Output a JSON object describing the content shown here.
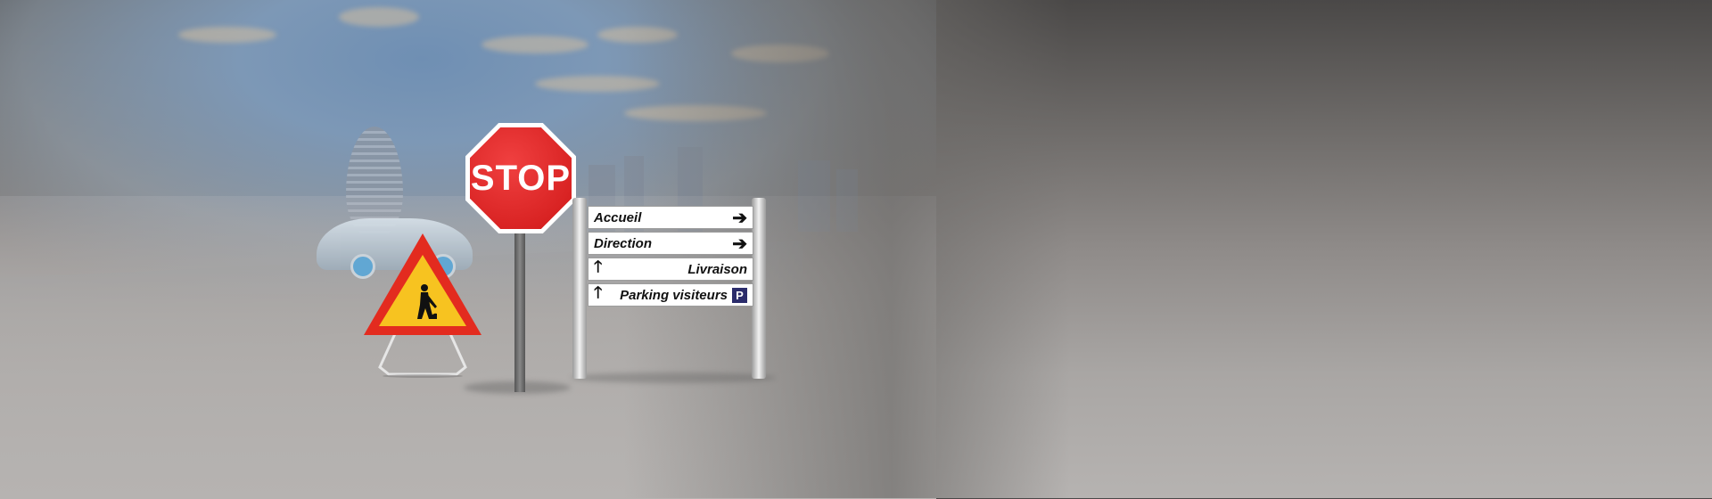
{
  "stop_sign": {
    "text": "STOP",
    "color": "#d01818"
  },
  "work_sign": {
    "icon": "road-work-icon",
    "border_color": "#e32b1f",
    "fill_color": "#f7c320"
  },
  "directional_panel": {
    "signs": [
      {
        "label": "Accueil",
        "arrow": "➔",
        "direction": "right"
      },
      {
        "label": "Direction",
        "arrow": "➔",
        "direction": "right"
      },
      {
        "label": "Livraison",
        "arrow": "🡑",
        "direction": "up"
      },
      {
        "label": "Parking visiteurs",
        "arrow": "🡑",
        "direction": "up",
        "badge": "P"
      }
    ],
    "badge_color": "#2b2c6b"
  }
}
